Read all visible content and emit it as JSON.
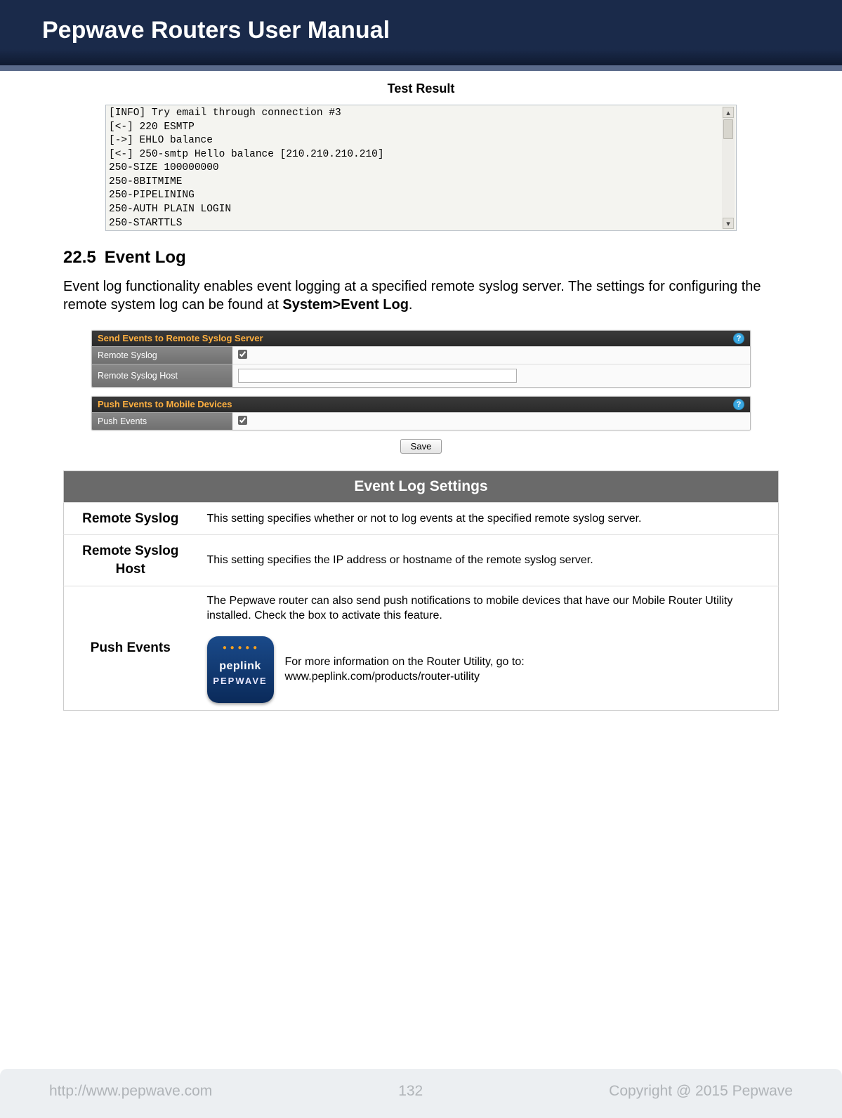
{
  "header": {
    "title": "Pepwave Routers User Manual"
  },
  "test_result": {
    "title": "Test Result",
    "lines": [
      "[INFO] Try email through connection #3",
      "[<-] 220 ESMTP",
      "[->] EHLO balance",
      "[<-] 250-smtp Hello balance [210.210.210.210]",
      "250-SIZE 100000000",
      "250-8BITMIME",
      "250-PIPELINING",
      "250-AUTH PLAIN LOGIN",
      "250-STARTTLS"
    ]
  },
  "section": {
    "number": "22.5",
    "title": "Event Log",
    "paragraph_pre": "Event log functionality enables event logging at a specified remote syslog server. The settings for configuring the remote system log can be found at ",
    "paragraph_bold": "System>Event Log",
    "paragraph_post": "."
  },
  "config": {
    "panel1_title": "Send Events to Remote Syslog Server",
    "row_remote_syslog": "Remote Syslog",
    "row_remote_syslog_host": "Remote Syslog Host",
    "panel2_title": "Push Events to Mobile Devices",
    "row_push_events": "Push Events",
    "save_label": "Save"
  },
  "settings_table": {
    "title": "Event Log Settings",
    "rows": {
      "remote_syslog": {
        "label": "Remote Syslog",
        "desc": "This setting specifies whether or not to log events at the specified remote syslog server."
      },
      "remote_syslog_host": {
        "label": "Remote Syslog Host",
        "desc": "This setting specifies the IP address or hostname of the remote syslog server."
      },
      "push_events": {
        "label": "Push Events",
        "desc": "The Pepwave router can also send push notifications to mobile devices that have our Mobile Router Utility installed. Check the box to activate this feature.",
        "more_line1": "For more information on the Router Utility, go to:",
        "more_line2": "www.peplink.com/products/router-utility"
      }
    }
  },
  "app_icon": {
    "brand1": "peplink",
    "brand2": "PEPWAVE"
  },
  "footer": {
    "url": "http://www.pepwave.com",
    "page": "132",
    "copyright": "Copyright @ 2015 Pepwave"
  }
}
